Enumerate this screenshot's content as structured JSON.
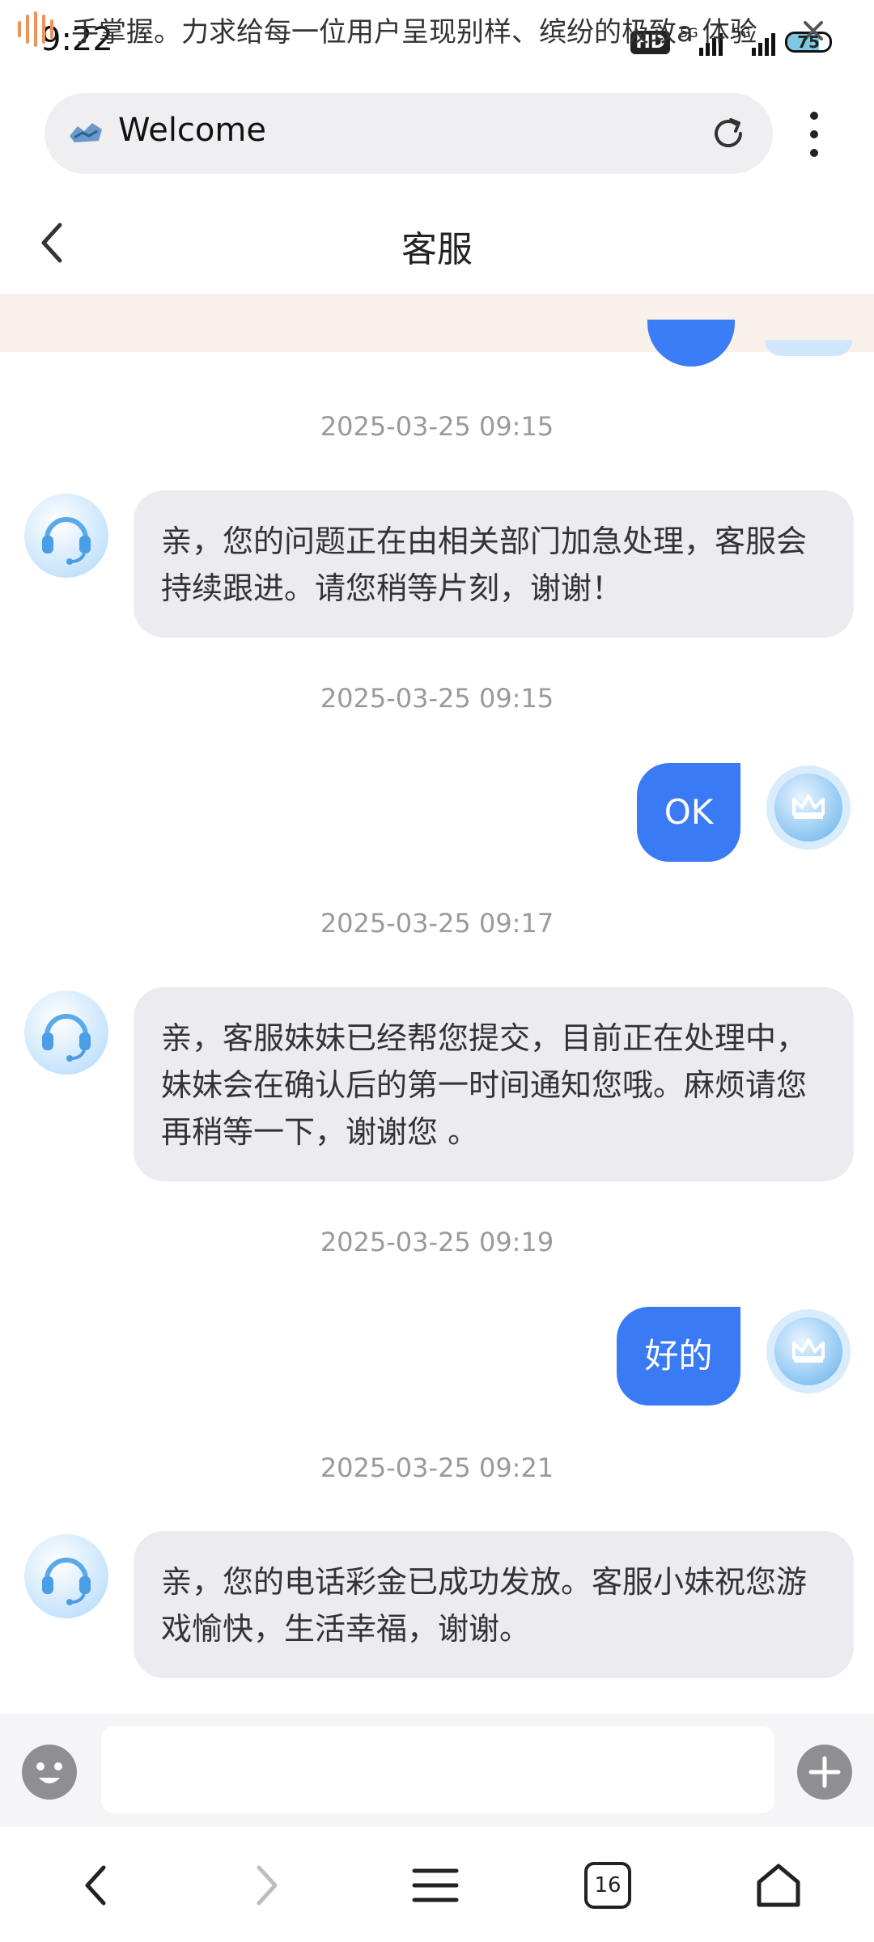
{
  "status_bar": {
    "time": "9:22",
    "hd_label": "HD",
    "sim1_label": "5G",
    "sim2_label": "5G",
    "battery": "75"
  },
  "browser": {
    "url_text": "Welcome",
    "icons": {
      "logo": "site-logo-icon",
      "reload": "reload-icon",
      "menu": "more-vert-icon"
    }
  },
  "header": {
    "title": "客服"
  },
  "notice": {
    "text": "手掌握。力求给每一位用户呈现别样、缤纷的极致a 体验"
  },
  "messages": [
    {
      "timestamp": "2025-03-25 09:15",
      "from": "agent",
      "text": "亲，您的问题正在由相关部门加急处理，客服会持续跟进。请您稍等片刻，谢谢！"
    },
    {
      "timestamp": "2025-03-25 09:15",
      "from": "user",
      "text": "OK"
    },
    {
      "timestamp": "2025-03-25 09:17",
      "from": "agent",
      "text": "亲，客服妹妹已经帮您提交，目前正在处理中，妹妹会在确认后的第一时间通知您哦。麻烦请您再稍等一下，谢谢您 。"
    },
    {
      "timestamp": "2025-03-25 09:19",
      "from": "user",
      "text": "好的"
    },
    {
      "timestamp": "2025-03-25 09:21",
      "from": "agent",
      "text": "亲，您的电话彩金已成功发放。客服小妹祝您游戏愉快，生活幸福，谢谢。"
    }
  ],
  "input": {
    "value": "",
    "placeholder": ""
  },
  "bottom_nav": {
    "tab_count": "16",
    "icons": [
      "back-icon",
      "forward-icon",
      "menu-icon",
      "tabs-icon",
      "home-icon"
    ]
  },
  "colors": {
    "accent": "#3a7af5",
    "agent_bubble": "#ececf0",
    "notice_bg": "#f7f1ea",
    "notice_icon": "#f0925a"
  }
}
